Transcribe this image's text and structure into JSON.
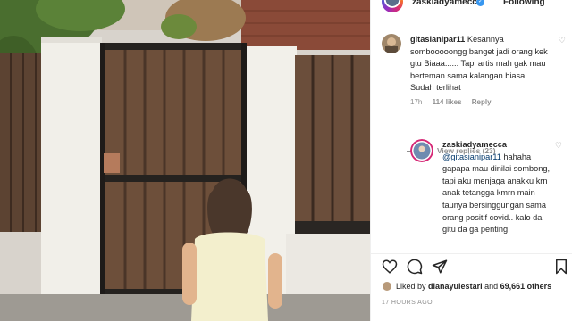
{
  "post": {
    "author": "zaskiadyamecca",
    "follow_label": "Following",
    "verified_mark": "✓"
  },
  "comments": [
    {
      "username": "gitasianipar11",
      "text": "Kesannya sombooooongg banget jadi orang kek gtu Biaaa...... Tapi artis mah gak mau berteman sama kalangan biasa..... Sudah terlihat",
      "time": "17h",
      "likes": "114 likes",
      "reply_label": "Reply"
    },
    {
      "username": "zaskiadyamecca",
      "mention": "@gitasianipar11",
      "text": "hahaha gapapa mau dinilai sombong, tapi aku menjaga anakku krn anak tetangga kmrn main taunya bersinggungan sama orang positif covid.. kalo da gitu da ga penting"
    }
  ],
  "view_replies": "View replies (23)",
  "likes": {
    "prefix": "Liked by",
    "user": "dianayulestari",
    "connector": "and",
    "count": "69,661 others"
  },
  "timestamp": "17 HOURS AGO",
  "icons": [
    "heart-icon",
    "comment-icon",
    "share-icon",
    "bookmark-icon",
    "verified-icon"
  ],
  "colors": {
    "mention": "#00376b",
    "secondary_text": "#8e8e8e",
    "verified": "#3897f0"
  }
}
